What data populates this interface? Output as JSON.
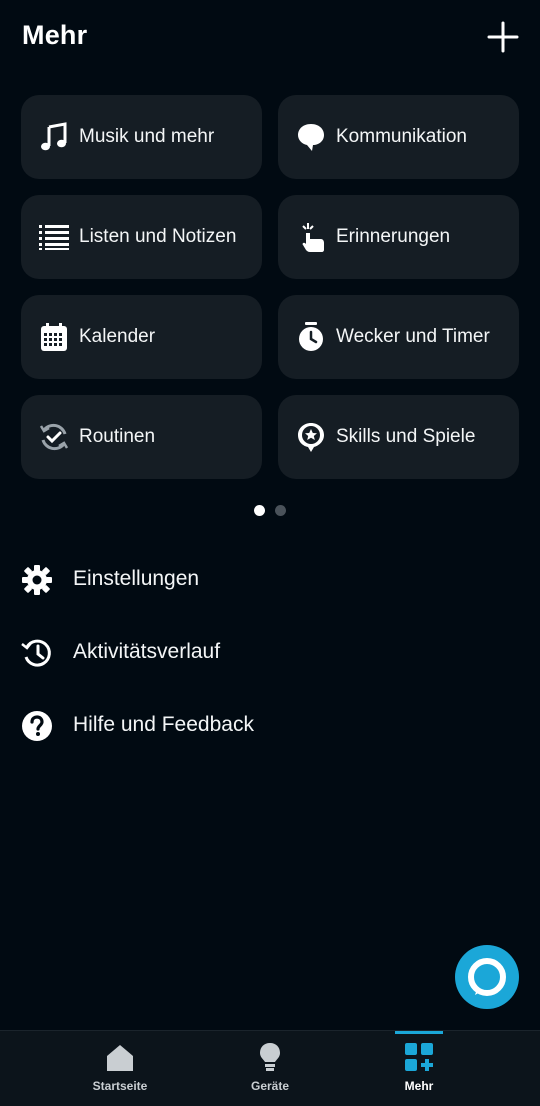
{
  "header": {
    "title": "Mehr",
    "add_icon": "plus-icon"
  },
  "tiles": [
    {
      "label": "Musik und mehr",
      "icon": "music-note-icon"
    },
    {
      "label": "Kommunikation",
      "icon": "speech-bubble-icon"
    },
    {
      "label": "Listen und Notizen",
      "icon": "list-icon"
    },
    {
      "label": "Erinnerungen",
      "icon": "reminder-hand-icon"
    },
    {
      "label": "Kalender",
      "icon": "calendar-icon"
    },
    {
      "label": "Wecker und Timer",
      "icon": "alarm-clock-icon"
    },
    {
      "label": "Routinen",
      "icon": "routine-cycle-icon"
    },
    {
      "label": "Skills und Spiele",
      "icon": "skills-star-icon"
    }
  ],
  "pagination": {
    "pages": 2,
    "current": 1
  },
  "menu": [
    {
      "label": "Einstellungen",
      "icon": "gear-icon"
    },
    {
      "label": "Aktivitätsverlauf",
      "icon": "history-icon"
    },
    {
      "label": "Hilfe und Feedback",
      "icon": "help-icon"
    }
  ],
  "alexa_button": {
    "icon": "alexa-icon"
  },
  "bottom_nav": [
    {
      "label": "Startseite",
      "icon": "home-icon"
    },
    {
      "label": "Geräte",
      "icon": "bulb-icon"
    },
    {
      "label": "Mehr",
      "icon": "more-grid-icon",
      "active": true
    }
  ],
  "colors": {
    "background": "#010a12",
    "tile": "#151d24",
    "accent": "#1ba7d8",
    "nav": "#0c141b"
  }
}
